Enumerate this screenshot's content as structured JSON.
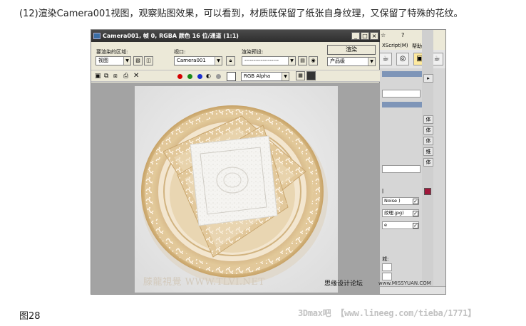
{
  "article": {
    "caption": "(12)渲染Camera001视图，观察贴图效果，可以看到，材质既保留了纸张自身纹理，又保留了特殊的花纹。",
    "figure_label": "图28",
    "source_text": "3Dmax吧 【www.lineeg.com/tieba/1771】"
  },
  "render_window": {
    "title": "Camera001, 帧 0, RGBA 颜色 16 位/通道 (1:1)",
    "area_label": "要渲染的区域:",
    "area_value": "视图",
    "viewport_label": "视口:",
    "viewport_value": "Camera001",
    "preset_label": "渲染预设:",
    "preset_value": "-------------------",
    "render_button": "渲染",
    "mode_value": "产品级",
    "channel_value": "RGB Alpha",
    "colors": {
      "red": "#d40000",
      "green": "#1a8a1a",
      "blue": "#1a2ed0"
    },
    "image_watermark": "滕龍視覺 WWW.TLVI.NET",
    "render_subject": "porcelain plate with gold floral pattern and folded textured paper napkin"
  },
  "background_app": {
    "help_label": "帮助(H)",
    "maxscript_label": "XScript(M)",
    "panel_items": [
      "体",
      "体",
      "体",
      "维",
      "体"
    ],
    "noise_label": "Noise )",
    "map_label": "纹理.jpg)",
    "number_label": "城:",
    "swatch_color": "#a0173a"
  },
  "overlay": {
    "forum_text": "思缘设计论坛",
    "forum_url": "www.MISSYUAN.COM"
  }
}
